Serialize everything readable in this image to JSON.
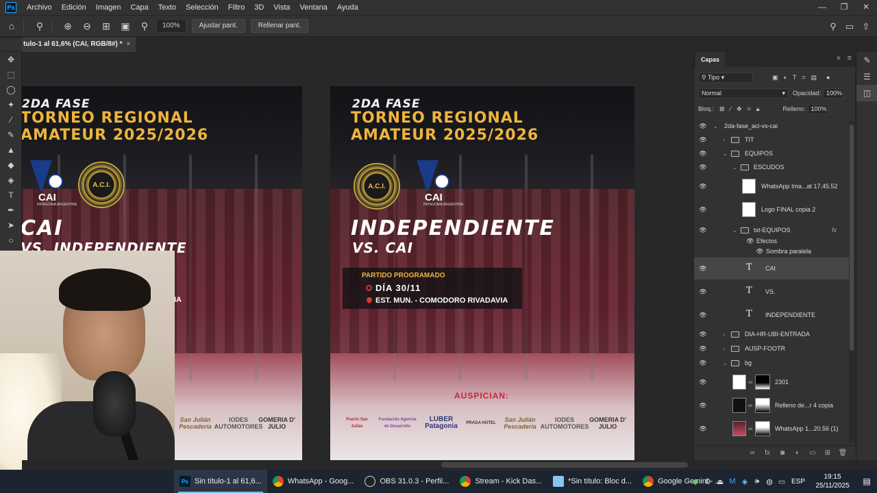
{
  "menubar": {
    "logo": "Ps",
    "items": [
      "Archivo",
      "Edición",
      "Imagen",
      "Capa",
      "Texto",
      "Selección",
      "Filtro",
      "3D",
      "Vista",
      "Ventana",
      "Ayuda"
    ]
  },
  "options": {
    "zoom_value": "100%",
    "fit_label": "Ajustar pant.",
    "fill_label": "Rellenar pant."
  },
  "document": {
    "tab_title": "tulo-1 al 61,6% (CAI, RGB/8#) *",
    "close": "×"
  },
  "poster": {
    "fase": "2DA FASE",
    "torneo_line1": "TORNEO REGIONAL",
    "torneo_line2": "AMATEUR 2025/2026",
    "team1": "INDEPENDIENTE",
    "team2": "VS. CAI",
    "left_team1": "CAI",
    "left_team2": "VS. INDEPENDIENTE",
    "crest_text": "A.C.I.",
    "cai_text": "CAI",
    "cai_sub": "PATAGONIA ARGENTINA",
    "match_header": "PARTIDO PROGRAMADO",
    "match_day": "DÍA 30/11",
    "match_place": "EST. MUN. - COMODORO RIVADAVIA",
    "left_place_fragment": "IA",
    "auspician": "AUSPICIAN:",
    "sponsors": [
      "Puerto San Julián",
      "Fundación Agencia de Desarrollo",
      "LUBER Patagonia",
      "PRAGA HOTEL",
      "San Julián Pescadería",
      "IODES AUTOMOTORES",
      "GOMERIA D' JULIO"
    ]
  },
  "layers_panel": {
    "tab": "Capas",
    "filter": "Tipo",
    "blend": "Normal",
    "opacity_label": "Opacidad:",
    "opacity_value": "100%",
    "lock_label": "Bloq.:",
    "fill_label": "Relleno:",
    "fill_value": "100%",
    "layers": [
      {
        "name": "2da-fase_aci-vs-cai",
        "kind": "folder"
      },
      {
        "name": "TIT",
        "kind": "folder"
      },
      {
        "name": "EQUIPOS",
        "kind": "folder"
      },
      {
        "name": "ESCUDOS",
        "kind": "folder"
      },
      {
        "name": "WhatsApp Ima...at 17.45.52",
        "kind": "image"
      },
      {
        "name": "Logo FINAL copia 2",
        "kind": "image"
      },
      {
        "name": "txt-EQUIPOS",
        "kind": "folder"
      },
      {
        "name": "Efectos",
        "kind": "effects"
      },
      {
        "name": "Sombra paralela",
        "kind": "effect"
      },
      {
        "name": "CAI",
        "kind": "text"
      },
      {
        "name": "VS.",
        "kind": "text"
      },
      {
        "name": "INDEPENDIENTE",
        "kind": "text"
      },
      {
        "name": "DIA-HR-UBI-ENTRADA",
        "kind": "folder"
      },
      {
        "name": "AUSP-FOOTR",
        "kind": "folder"
      },
      {
        "name": "bg",
        "kind": "folder"
      },
      {
        "name": "2301",
        "kind": "image"
      },
      {
        "name": "Relleno de...r 4 copia",
        "kind": "fill"
      },
      {
        "name": "WhatsApp 1...20.56 (1)",
        "kind": "image"
      }
    ],
    "fx_label": "fx"
  },
  "taskbar": {
    "items": [
      {
        "label": "Sin título-1 al 61,6...",
        "icon": "Ps"
      },
      {
        "label": "WhatsApp - Goog...",
        "icon": "chrome"
      },
      {
        "label": "OBS 31.0.3 - Perfil...",
        "icon": "obs"
      },
      {
        "label": "Stream - Kick Das...",
        "icon": "chrome"
      },
      {
        "label": "*Sin título: Bloc d...",
        "icon": "notepad"
      },
      {
        "label": "Google Gemini - ...",
        "icon": "chrome"
      }
    ],
    "lang": "ESP",
    "time": "19:15",
    "date": "25/11/2025"
  }
}
